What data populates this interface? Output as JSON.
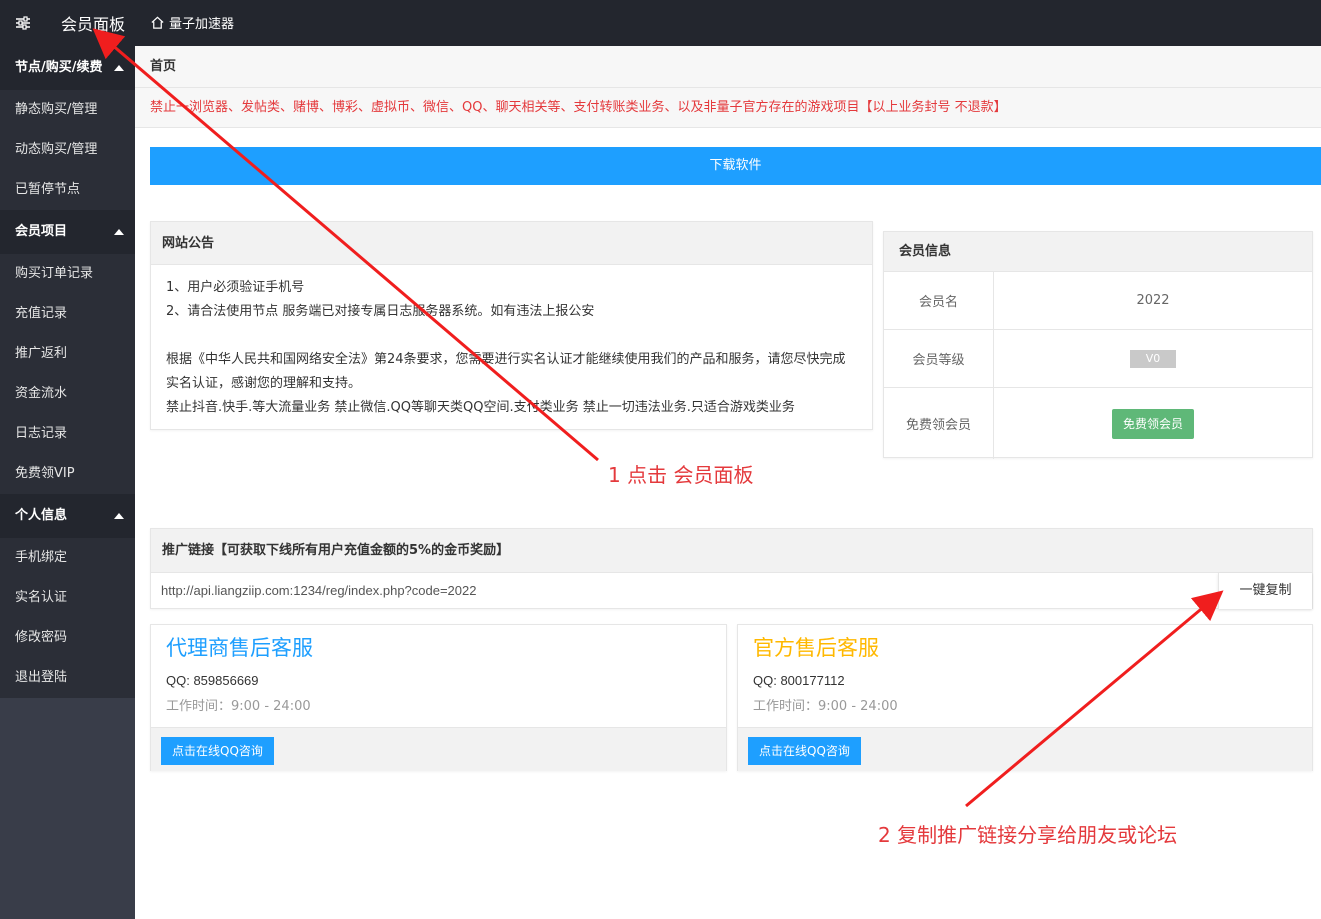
{
  "topbar": {
    "menu_icon": "sliders-icon",
    "panel_title": "会员面板",
    "home_label": "量子加速器"
  },
  "sidebar": {
    "sections": [
      {
        "title": "节点/购买/续费",
        "items": [
          "静态购买/管理",
          "动态购买/管理",
          "已暂停节点"
        ]
      },
      {
        "title": "会员项目",
        "items": [
          "购买订单记录",
          "充值记录",
          "推广返利",
          "资金流水",
          "日志记录",
          "免费领VIP"
        ]
      },
      {
        "title": "个人信息",
        "items": [
          "手机绑定",
          "实名认证",
          "修改密码",
          "退出登陆"
        ]
      }
    ]
  },
  "main": {
    "breadcrumb": "首页",
    "red_notice": "禁止一浏览器、发帖类、赌博、博彩、虚拟币、微信、QQ、聊天相关等、支付转账类业务、以及非量子官方存在的游戏项目【以上业务封号 不退款】",
    "download_label": "下载软件",
    "announcement": {
      "title": "网站公告",
      "line1": "1、用户必须验证手机号",
      "line2": "2、请合法使用节点 服务端已对接专属日志服务器系统。如有违法上报公安",
      "line3": "根据《中华人民共和国网络安全法》第24条要求，您需要进行实名认证才能继续使用我们的产品和服务，请您尽快完成实名认证，感谢您的理解和支持。",
      "line4": "禁止抖音.快手.等大流量业务 禁止微信.QQ等聊天类QQ空间.支付类业务 禁止一切违法业务.只适合游戏类业务"
    },
    "member_info": {
      "title": "会员信息",
      "name_label": "会员名",
      "name_value": "2022",
      "level_label": "会员等级",
      "level_value": "V0",
      "free_label": "免费领会员",
      "free_button": "免费领会员"
    },
    "promo": {
      "title": "推广链接【可获取下线所有用户充值金额的5%的金币奖励】",
      "url": "http://api.liangziip.com:1234/reg/index.php?code=2022",
      "copy_label": "一键复制"
    },
    "services": [
      {
        "title": "代理商售后客服",
        "qq": "QQ: 859856669",
        "hours": "工作时间：9:00 - 24:00",
        "button": "点击在线QQ咨询"
      },
      {
        "title": "官方售后客服",
        "qq": "QQ: 800177112",
        "hours": "工作时间：9:00 - 24:00",
        "button": "点击在线QQ咨询"
      }
    ]
  },
  "annotations": {
    "step1": "1 点击 会员面板",
    "step2": "2 复制推广链接分享给朋友或论坛"
  },
  "colors": {
    "topbar_bg": "#23262e",
    "sidebar_bg": "#393d49",
    "accent_blue": "#1e9fff",
    "accent_green": "#5fb878",
    "accent_yellow": "#ffb800",
    "annotation_red": "#e4393c"
  }
}
